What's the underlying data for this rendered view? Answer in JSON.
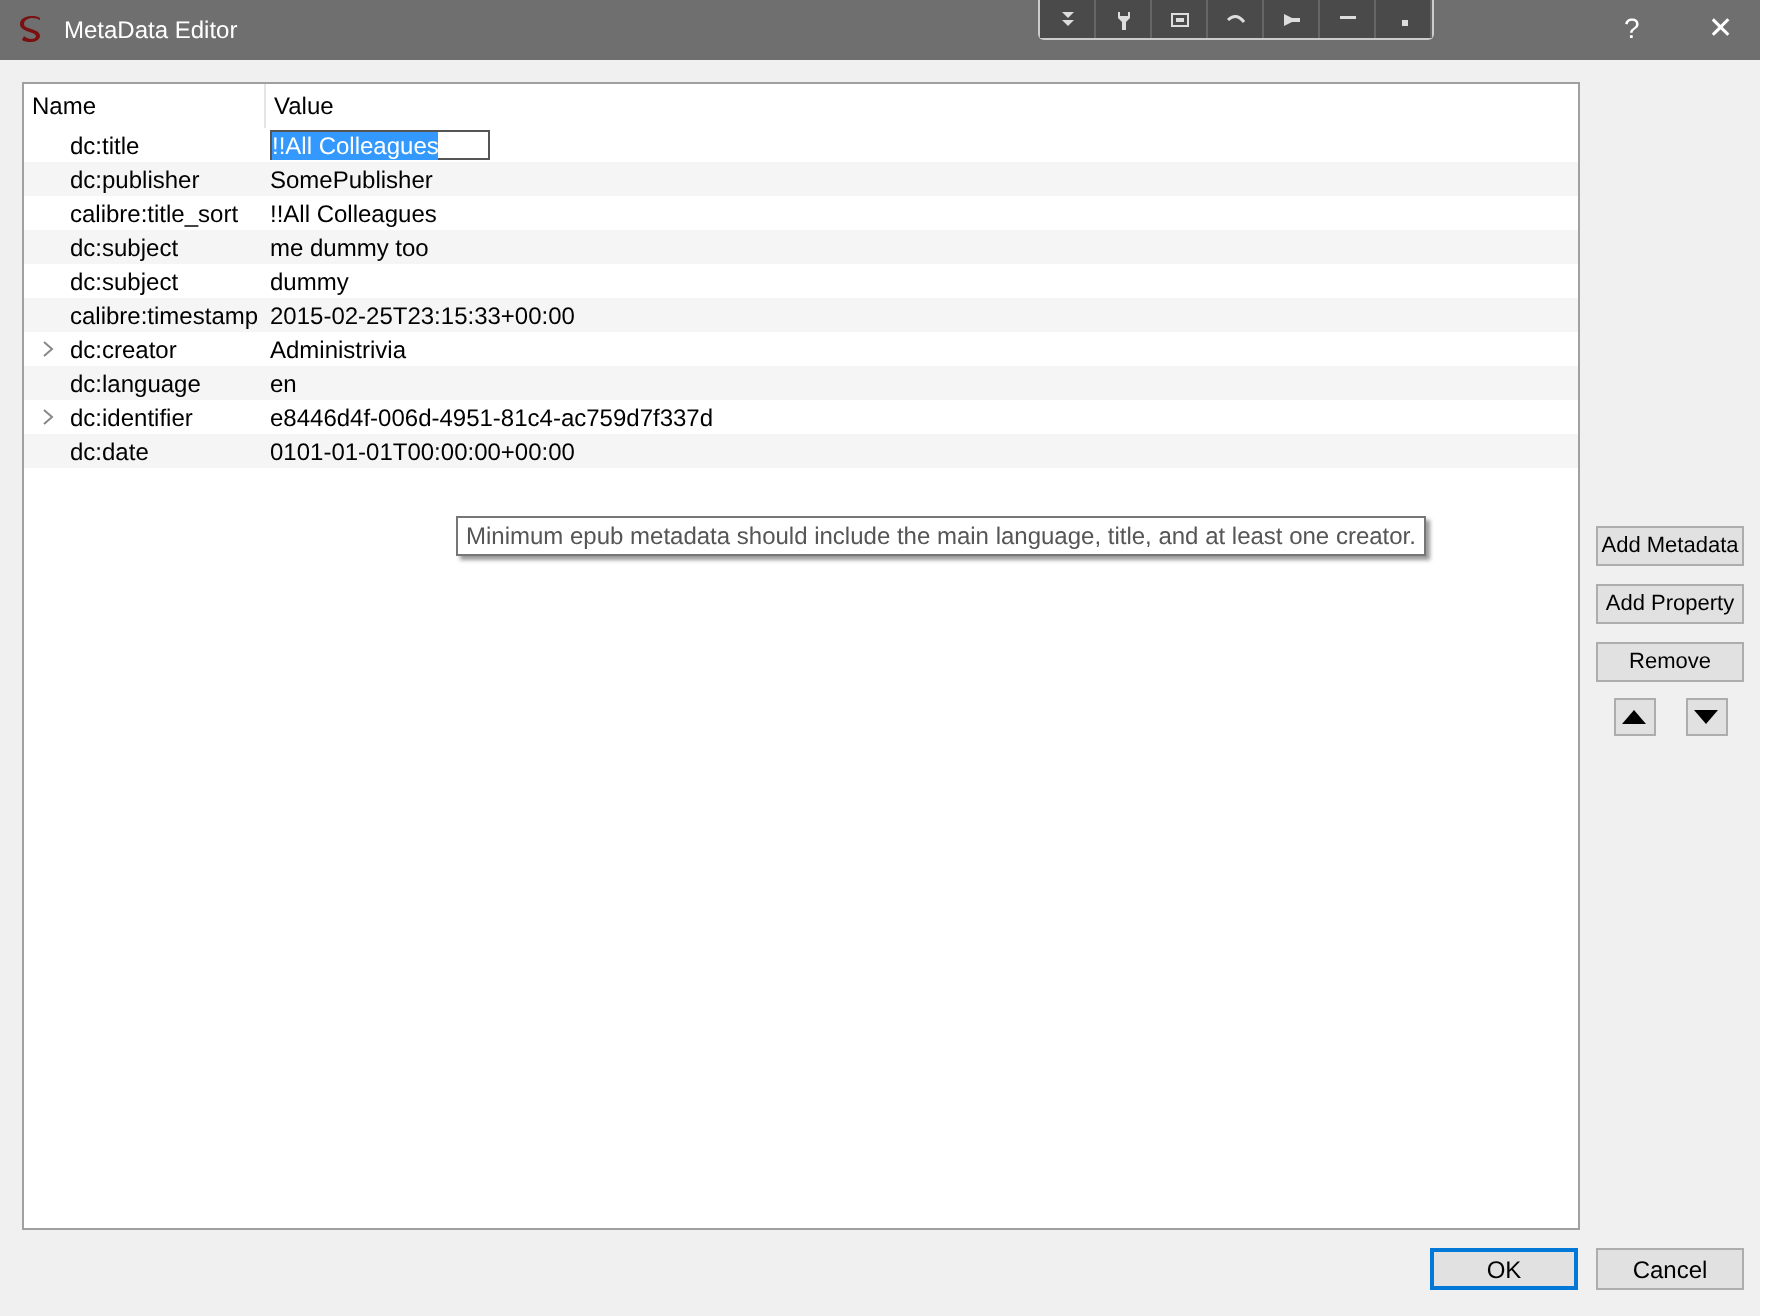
{
  "window": {
    "title": "MetaData Editor",
    "help": "?",
    "close": "✕"
  },
  "table": {
    "columns": [
      "Name",
      "Value"
    ],
    "rows": [
      {
        "name": "dc:title",
        "value": "!!All Colleagues",
        "editing": true,
        "expandable": false
      },
      {
        "name": "dc:publisher",
        "value": "SomePublisher",
        "editing": false,
        "expandable": false
      },
      {
        "name": "calibre:title_sort",
        "value": "!!All Colleagues",
        "editing": false,
        "expandable": false
      },
      {
        "name": "dc:subject",
        "value": "me dummy too",
        "editing": false,
        "expandable": false
      },
      {
        "name": "dc:subject",
        "value": "dummy",
        "editing": false,
        "expandable": false
      },
      {
        "name": "calibre:timestamp",
        "value": "2015-02-25T23:15:33+00:00",
        "editing": false,
        "expandable": false
      },
      {
        "name": "dc:creator",
        "value": "Administrivia",
        "editing": false,
        "expandable": true
      },
      {
        "name": "dc:language",
        "value": "en",
        "editing": false,
        "expandable": false
      },
      {
        "name": "dc:identifier",
        "value": "e8446d4f-006d-4951-81c4-ac759d7f337d",
        "editing": false,
        "expandable": true
      },
      {
        "name": "dc:date",
        "value": "0101-01-01T00:00:00+00:00",
        "editing": false,
        "expandable": false
      }
    ]
  },
  "tooltip": "Minimum epub metadata should include the main language, title, and at least one creator.",
  "side_buttons": [
    "Add Metadata",
    "Add Property",
    "Remove"
  ],
  "buttons": [
    {
      "label": "OK",
      "default": true
    },
    {
      "label": "Cancel",
      "default": false
    }
  ]
}
